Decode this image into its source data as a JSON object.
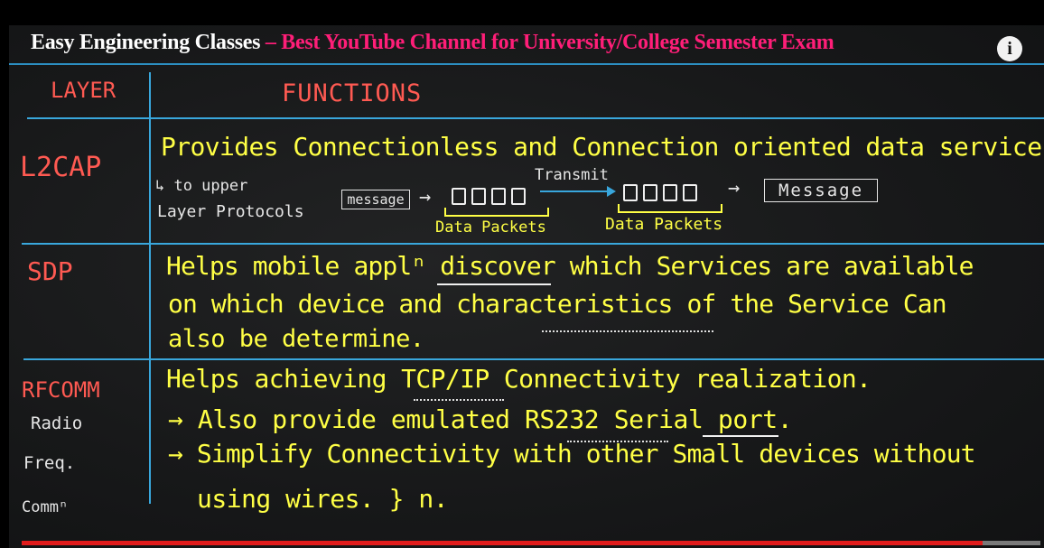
{
  "banner": {
    "channel": "Easy Engineering Classes",
    "tagline": " – Best YouTube Channel for University/College Semester Exam"
  },
  "info_icon": "i",
  "headers": {
    "layer": "LAYER",
    "functions": "FUNCTIONS"
  },
  "rows": {
    "l2cap": {
      "layer": "L2CAP",
      "function": "Provides Connectionless and Connection oriented data services.",
      "note_line1": "↳ to upper",
      "note_line2": "Layer Protocols",
      "message_in": "message",
      "arrow": "→",
      "transmit": "Transmit",
      "packets_left": "Data Packets",
      "packets_right": "Data Packets",
      "message_out": "Message"
    },
    "sdp": {
      "layer": "SDP",
      "line1": "Helps mobile applⁿ discover which Services are available",
      "line2": "on which device and characteristics of the Service Can",
      "line3": "also be determine."
    },
    "rfcomm": {
      "layer": "RFCOMM",
      "sub1": "Radio",
      "sub2": "Freq.",
      "sub3": "Commⁿ",
      "line1": "Helps achieving TCP/IP Connectivity realization.",
      "line2": "→ Also provide emulated RS232 Serial port.",
      "line3": "→ Simplify Connectivity with other Small devices without",
      "line4": "using wires. } n."
    }
  },
  "video": {
    "progress_fraction": 0.943,
    "accent_color": "#e11c1c"
  }
}
